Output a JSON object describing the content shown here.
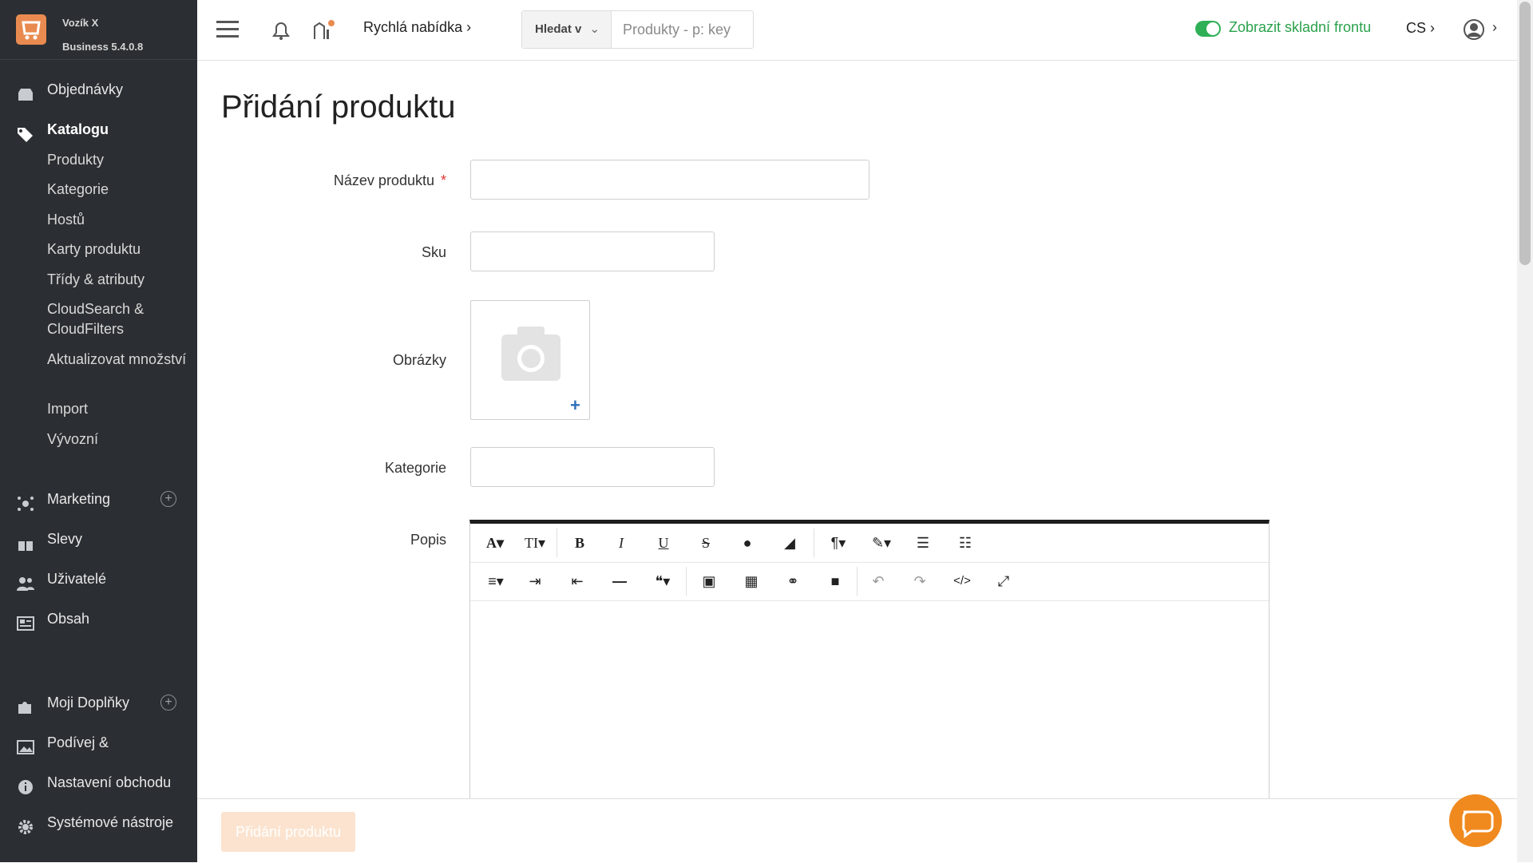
{
  "brand": {
    "name": "Vozík X",
    "edition": "Business 5.4.0.8"
  },
  "sidebar": {
    "items": [
      {
        "label": "Objednávky",
        "icon": "orders-icon"
      },
      {
        "label": "Katalogu",
        "icon": "tag-icon",
        "active": true,
        "children": [
          "Produkty",
          "Kategorie",
          "Hostů",
          "Karty produktu",
          "Třídy & atributy",
          "CloudSearch & CloudFilters",
          "Aktualizovat množství",
          "Import",
          "Vývozní"
        ]
      },
      {
        "label": "Marketing",
        "icon": "marketing-icon",
        "addable": true
      },
      {
        "label": "Slevy",
        "icon": "gift-icon"
      },
      {
        "label": "Uživatelé",
        "icon": "users-icon"
      },
      {
        "label": "Obsah",
        "icon": "content-icon"
      },
      {
        "label": "Moji Doplňky",
        "icon": "puzzle-icon",
        "addable": true
      },
      {
        "label": "Podívej &",
        "icon": "image-icon"
      },
      {
        "label": "Nastavení obchodu",
        "icon": "info-icon"
      },
      {
        "label": "Systémové nástroje",
        "icon": "gear-icon"
      }
    ]
  },
  "header": {
    "quick_menu": "Rychlá nabídka",
    "search_scope": "Hledat v",
    "search_placeholder": "Produkty - p: key",
    "storefront_toggle": "Zobrazit skladní frontu",
    "language": "CS"
  },
  "page": {
    "title": "Přidání produktu",
    "fields": {
      "name_label": "Název produktu",
      "required_mark": "*",
      "sku_label": "Sku",
      "images_label": "Obrázky",
      "images_add": "+",
      "category_label": "Kategorie",
      "description_label": "Popis"
    },
    "editor_buttons": [
      "font",
      "text-size",
      "bold",
      "italic",
      "underline",
      "strikethrough",
      "color",
      "eraser",
      "paragraph",
      "style",
      "ordered-list",
      "unordered-list",
      "align",
      "indent",
      "outdent",
      "horizontal-rule",
      "quote",
      "image",
      "table",
      "link",
      "video",
      "undo",
      "redo",
      "code",
      "fullscreen"
    ],
    "submit_label": "Přidání produktu"
  },
  "colors": {
    "accent": "#e98b50",
    "sidebar_bg": "#2b2f33",
    "toggle_on": "#2fb056",
    "submit_disabled": "#fbe3cf",
    "chat": "#f08a1e"
  }
}
